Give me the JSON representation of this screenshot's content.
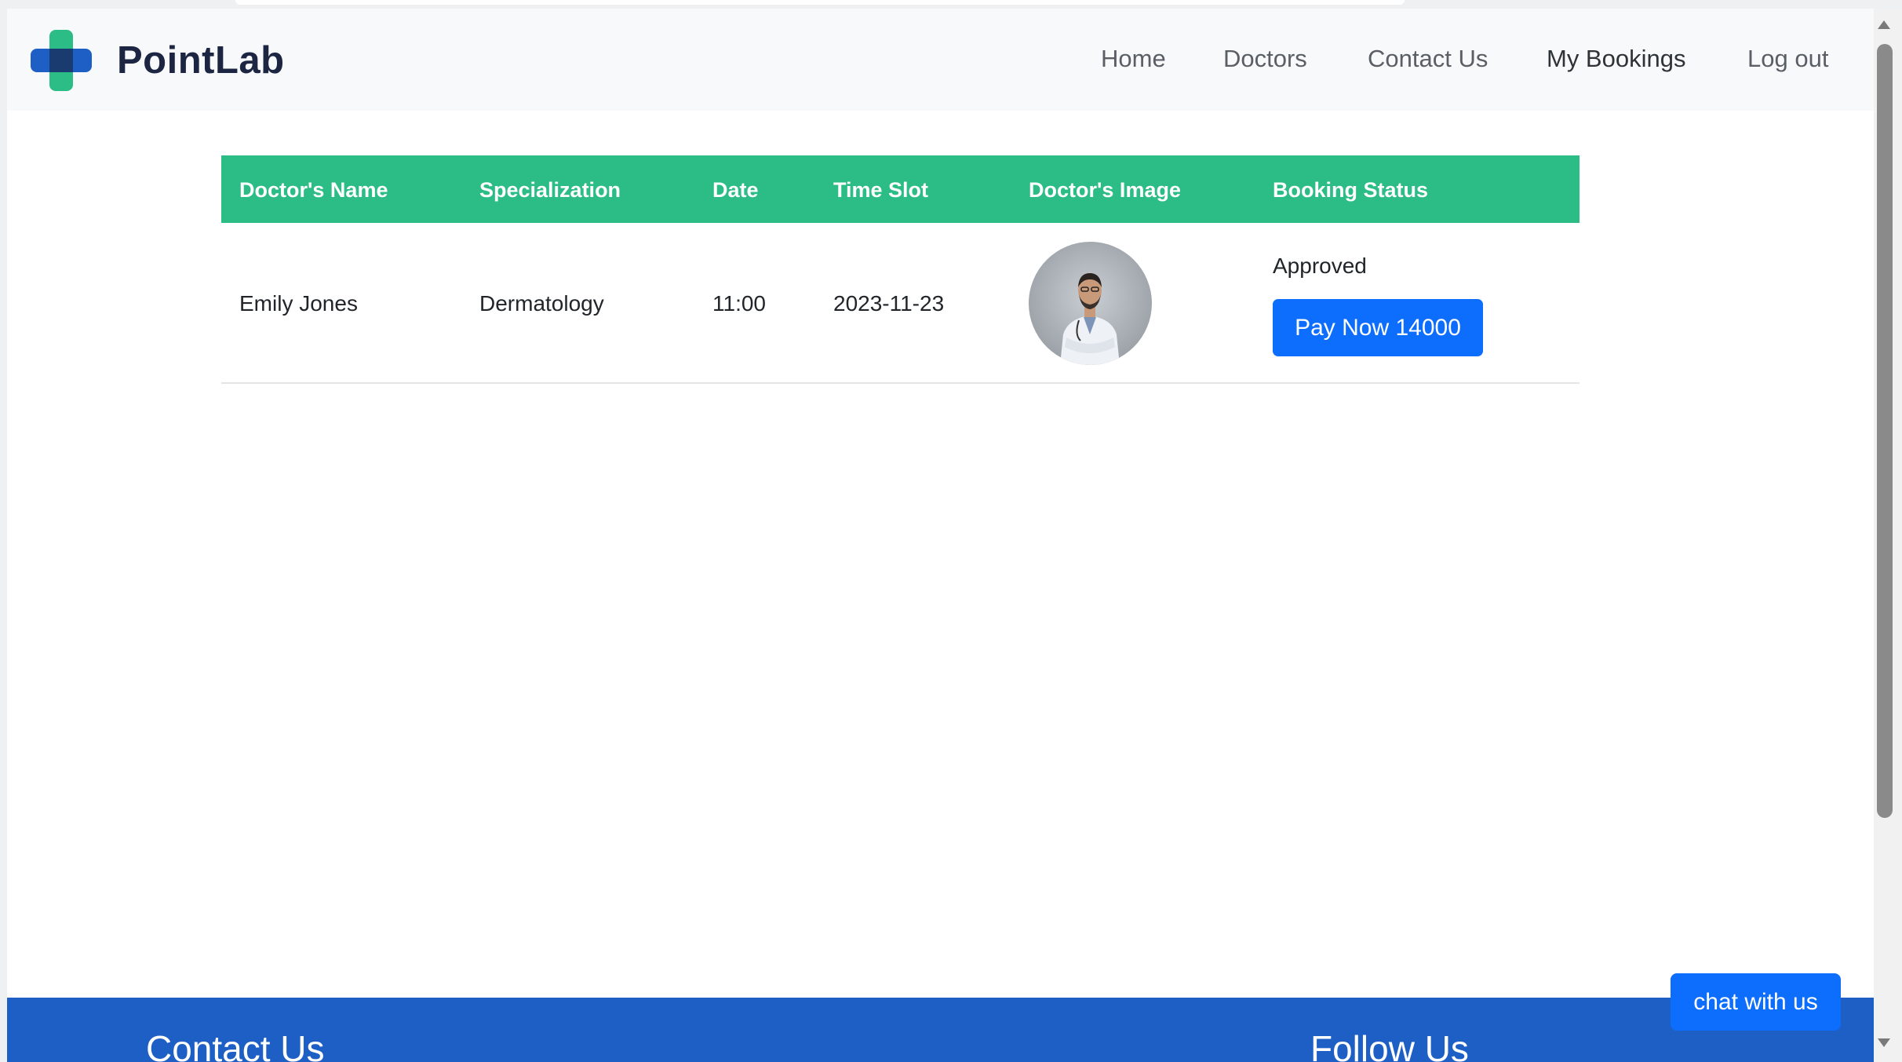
{
  "brand": {
    "name": "PointLab",
    "colors": {
      "green": "#2bbd85",
      "blue": "#1d5fc5",
      "dark": "#1a3b70"
    }
  },
  "nav": {
    "items": [
      {
        "label": "Home"
      },
      {
        "label": "Doctors"
      },
      {
        "label": "Contact Us"
      },
      {
        "label": "My Bookings",
        "active": true
      },
      {
        "label": "Log out"
      }
    ]
  },
  "bookings": {
    "header_color": "#2bbd85",
    "columns": [
      "Doctor's Name",
      "Specialization",
      "Date",
      "Time Slot",
      "Doctor's Image",
      "Booking Status"
    ],
    "rows": [
      {
        "doctor_name": "Emily Jones",
        "specialization": "Dermatology",
        "date": "11:00",
        "time_slot": "2023-11-23",
        "image_icon": "doctor-portrait",
        "status": "Approved",
        "pay_label": "Pay Now 14000"
      }
    ]
  },
  "footer": {
    "background": "#1d5fc5",
    "contact_heading": "Contact Us",
    "follow_heading": "Follow Us"
  },
  "chat": {
    "label": "chat with us"
  }
}
